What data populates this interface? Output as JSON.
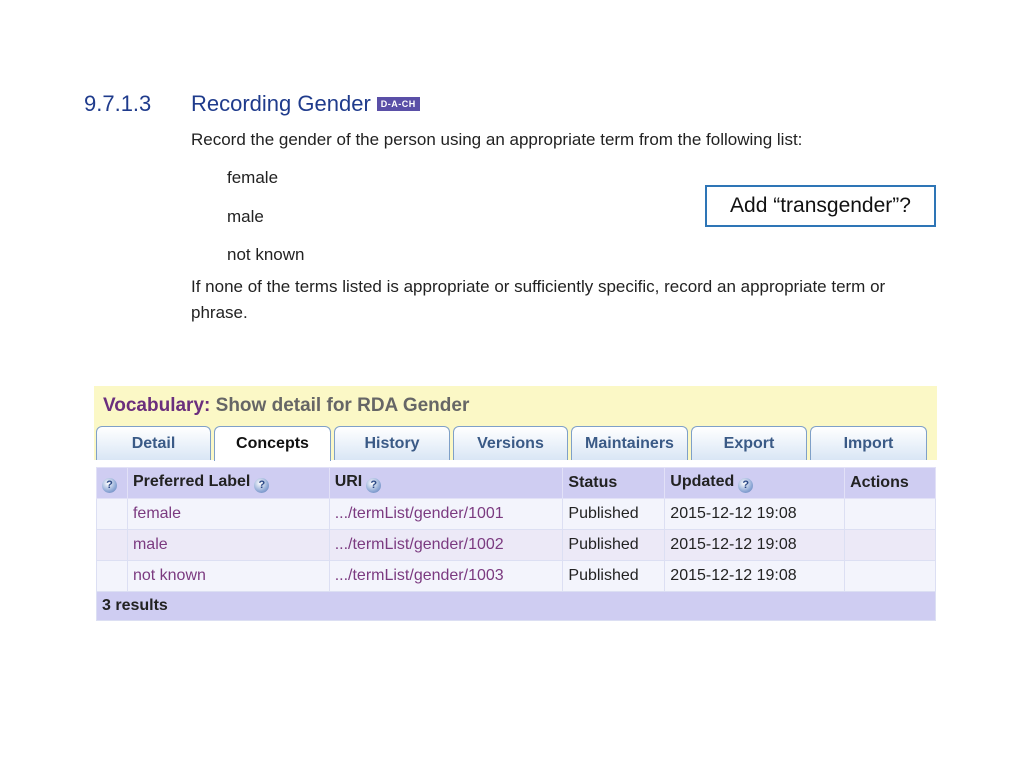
{
  "rule": {
    "number": "9.7.1.3",
    "title": "Recording Gender",
    "badge": "D-A-CH",
    "instruction": "Record the gender of the person using an appropriate term from the following list:",
    "terms": [
      "female",
      "male",
      "not known"
    ],
    "fallback_line1": "If none of the terms listed is appropriate or sufficiently specific, record an appropriate term or",
    "fallback_line2": "phrase."
  },
  "callout": {
    "text": "Add “transgender”?"
  },
  "vocabulary": {
    "title_lead": "Vocabulary:",
    "title_rest": "Show detail for RDA Gender",
    "tabs": [
      "Detail",
      "Concepts",
      "History",
      "Versions",
      "Maintainers",
      "Export",
      "Import"
    ],
    "active_tab": "Concepts",
    "columns": {
      "preferred_label": "Preferred Label",
      "uri": "URI",
      "status": "Status",
      "updated": "Updated",
      "actions": "Actions"
    },
    "rows": [
      {
        "label": "female",
        "uri": ".../termList/gender/1001",
        "status": "Published",
        "updated": "2015-12-12 19:08",
        "actions": ""
      },
      {
        "label": "male",
        "uri": ".../termList/gender/1002",
        "status": "Published",
        "updated": "2015-12-12 19:08",
        "actions": ""
      },
      {
        "label": "not known",
        "uri": ".../termList/gender/1003",
        "status": "Published",
        "updated": "2015-12-12 19:08",
        "actions": ""
      }
    ],
    "results_count": "3 results"
  },
  "icons": {
    "help": "help-icon"
  },
  "colors": {
    "heading_blue": "#1f3b8c",
    "link_purple": "#7b3a80",
    "header_lavender": "#cfcdf2",
    "panel_yellow": "#fbf8c6"
  }
}
